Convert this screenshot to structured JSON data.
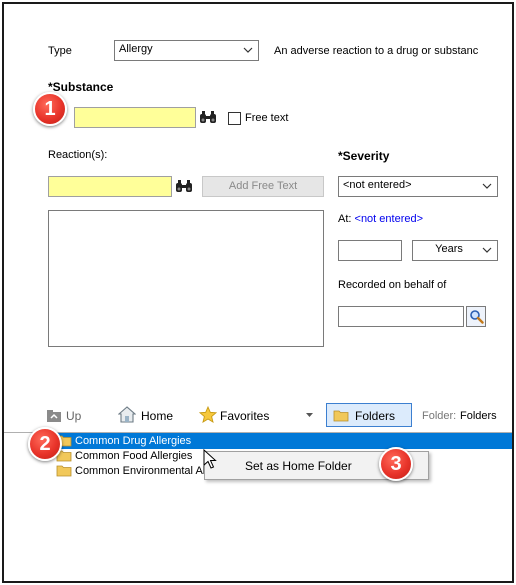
{
  "form": {
    "type_label": "Type",
    "type_value": "Allergy",
    "type_description": "An adverse reaction to a drug or substanc",
    "substance_label": "*Substance",
    "free_text_label": "Free text",
    "reactions_label": "Reaction(s):",
    "add_free_text_label": "Add Free Text",
    "severity_label": "*Severity",
    "severity_value": "<not entered>",
    "at_label": "At:",
    "at_value": "<not entered>",
    "years_value": "Years",
    "recorded_label": "Recorded on behalf of"
  },
  "toolbar": {
    "up_label": "Up",
    "home_label": "Home",
    "favorites_label": "Favorites",
    "folders_label": "Folders",
    "folder_label": "Folder:",
    "folder_value": "Folders"
  },
  "tree": {
    "items": [
      {
        "label": "Common Drug Allergies"
      },
      {
        "label": "Common Food Allergies"
      },
      {
        "label": "Common Environmental Allergies"
      }
    ]
  },
  "context_menu": {
    "item_label": "Set as Home Folder"
  },
  "badges": [
    "1",
    "2",
    "3"
  ],
  "colors": {
    "required_field": "#ffff99",
    "selection": "#0078d7",
    "link": "#0000ee",
    "badge": "#e8342a"
  }
}
